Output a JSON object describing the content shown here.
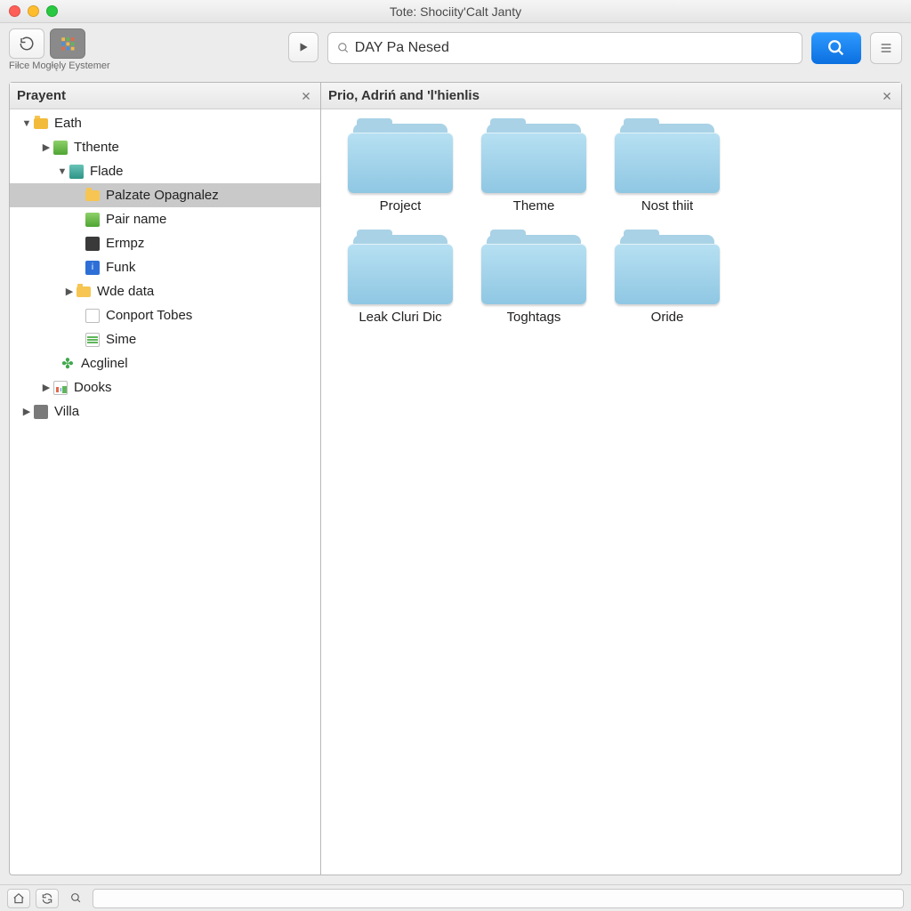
{
  "window": {
    "title": "Tote: Shociity'Calt Janty"
  },
  "toolbar": {
    "label": "Fiłce Mogłęly Eystemer"
  },
  "search": {
    "value": "DAY Pa Nesed"
  },
  "panes": {
    "left_title": "Prayent",
    "right_title": "Prio, Adriń and 'l'hienlis"
  },
  "tree": {
    "root": "Eath",
    "tthente": "Tthente",
    "flade": "Flade",
    "palzate": "Palzate Opagnalez",
    "pairname": "Pair name",
    "ermpz": "Ermpz",
    "funk": "Funk",
    "wdedata": "Wde data",
    "conport": "Conport Tobes",
    "sime": "Sime",
    "acglinel": "Acglinel",
    "dooks": "Dooks",
    "villa": "Villa"
  },
  "folders": [
    {
      "label": "Project"
    },
    {
      "label": "Theme"
    },
    {
      "label": "Nost thiit"
    },
    {
      "label": "Leak Cluri Dic"
    },
    {
      "label": "Toghtags"
    },
    {
      "label": "Oride"
    }
  ]
}
